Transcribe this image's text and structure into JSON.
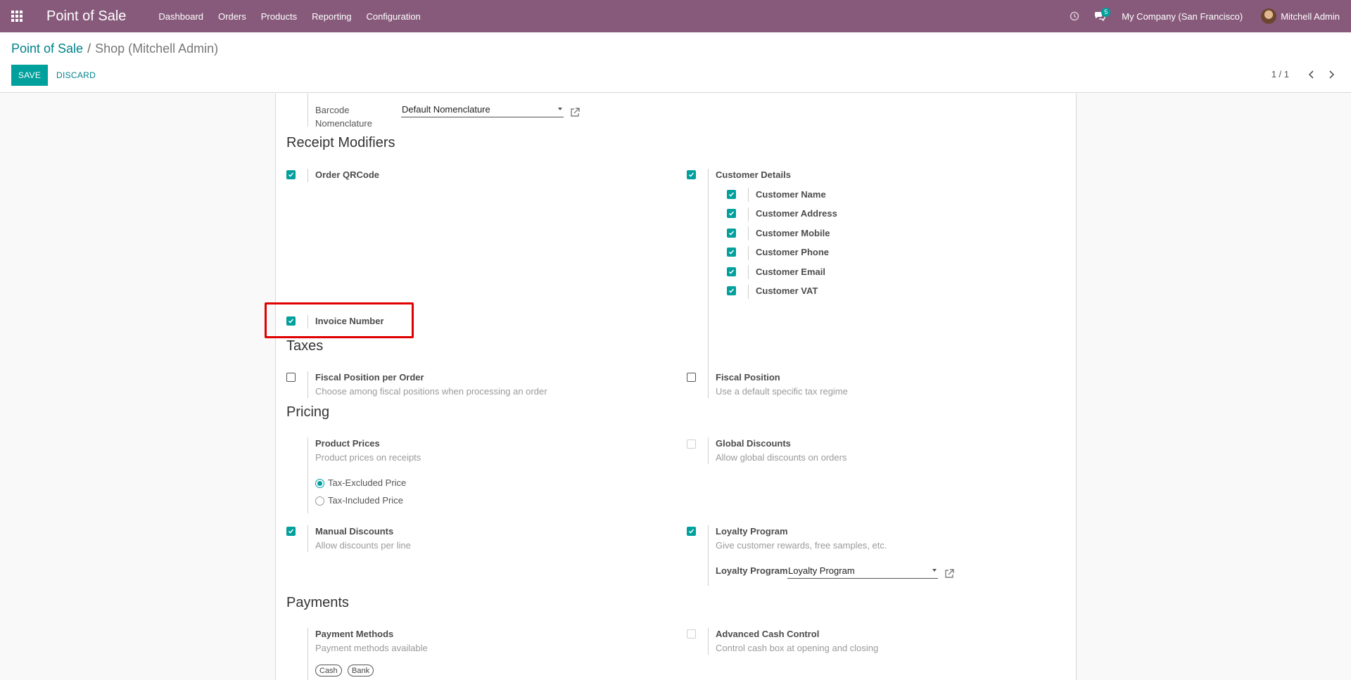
{
  "navbar": {
    "brand": "Point of Sale",
    "menu": [
      "Dashboard",
      "Orders",
      "Products",
      "Reporting",
      "Configuration"
    ],
    "chat_badge": "5",
    "company": "My Company (San Francisco)",
    "user": "Mitchell Admin"
  },
  "control": {
    "breadcrumb_root": "Point of Sale",
    "breadcrumb_sep": "/",
    "breadcrumb_current": "Shop (Mitchell Admin)",
    "save_label": "SAVE",
    "discard_label": "DISCARD",
    "pager": "1 / 1"
  },
  "barcode": {
    "label": "Barcode Nomenclature",
    "value": "Default Nomenclature"
  },
  "receipt": {
    "title": "Receipt Modifiers",
    "order_qrcode": {
      "label": "Order QRCode",
      "checked": true
    },
    "customer_details": {
      "label": "Customer Details",
      "checked": true
    },
    "customer_items": [
      {
        "label": "Customer Name",
        "checked": true
      },
      {
        "label": "Customer Address",
        "checked": true
      },
      {
        "label": "Customer Mobile",
        "checked": true
      },
      {
        "label": "Customer Phone",
        "checked": true
      },
      {
        "label": "Customer Email",
        "checked": true
      },
      {
        "label": "Customer VAT",
        "checked": true
      }
    ],
    "invoice_number": {
      "label": "Invoice Number",
      "checked": true
    }
  },
  "taxes": {
    "title": "Taxes",
    "fiscal_per_order": {
      "label": "Fiscal Position per Order",
      "desc": "Choose among fiscal positions when processing an order",
      "checked": false
    },
    "fiscal_position": {
      "label": "Fiscal Position",
      "desc": "Use a default specific tax regime",
      "checked": false
    }
  },
  "pricing": {
    "title": "Pricing",
    "product_prices": {
      "label": "Product Prices",
      "desc": "Product prices on receipts"
    },
    "price_options": [
      {
        "label": "Tax-Excluded Price",
        "selected": true
      },
      {
        "label": "Tax-Included Price",
        "selected": false
      }
    ],
    "global_discounts": {
      "label": "Global Discounts",
      "desc": "Allow global discounts on orders",
      "checked": false
    },
    "manual_discounts": {
      "label": "Manual Discounts",
      "desc": "Allow discounts per line",
      "checked": true
    },
    "loyalty": {
      "label": "Loyalty Program",
      "desc": "Give customer rewards, free samples, etc.",
      "checked": true,
      "field_label": "Loyalty Program",
      "field_value": "Loyalty Program"
    }
  },
  "payments": {
    "title": "Payments",
    "payment_methods": {
      "label": "Payment Methods",
      "desc": "Payment methods available",
      "tags": [
        "Cash",
        "Bank"
      ]
    },
    "cash_control": {
      "label": "Advanced Cash Control",
      "desc": "Control cash box at opening and closing",
      "checked": false
    }
  }
}
